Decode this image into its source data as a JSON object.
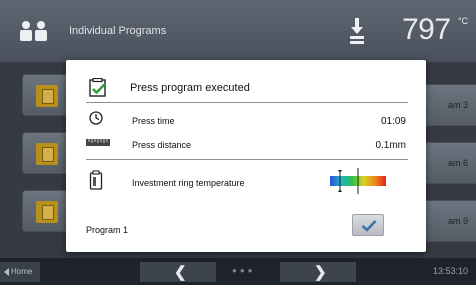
{
  "header": {
    "title": "Individual Programs",
    "temperature": "797",
    "temperature_unit": "°C",
    "people_icon": "user-group-icon",
    "furnace_icon": "furnace-icon"
  },
  "background_tiles": {
    "right_labels": [
      "am 3",
      "am 6",
      "am 9"
    ]
  },
  "dialog": {
    "title": "Press program executed",
    "rows": [
      {
        "label": "Press time",
        "value": "01:09",
        "icon": "clock-icon"
      },
      {
        "label": "Press distance",
        "value": "0.1mm",
        "icon": "ruler-icon"
      },
      {
        "label": "Investment ring temperature",
        "icon": "investment-ring-icon"
      }
    ],
    "program": "Program 1",
    "confirm_icon": "checkmark-icon"
  },
  "footer": {
    "home": "Home",
    "time": "13:53:10",
    "prev_icon": "chevron-left-icon",
    "next_icon": "chevron-right-icon"
  },
  "colors": {
    "confirm_check": "#3a6fb0",
    "tempbar": [
      "#2a4fd6",
      "#22b3c8",
      "#2fbf4a",
      "#d7d323",
      "#f08a1a",
      "#e02020"
    ]
  }
}
